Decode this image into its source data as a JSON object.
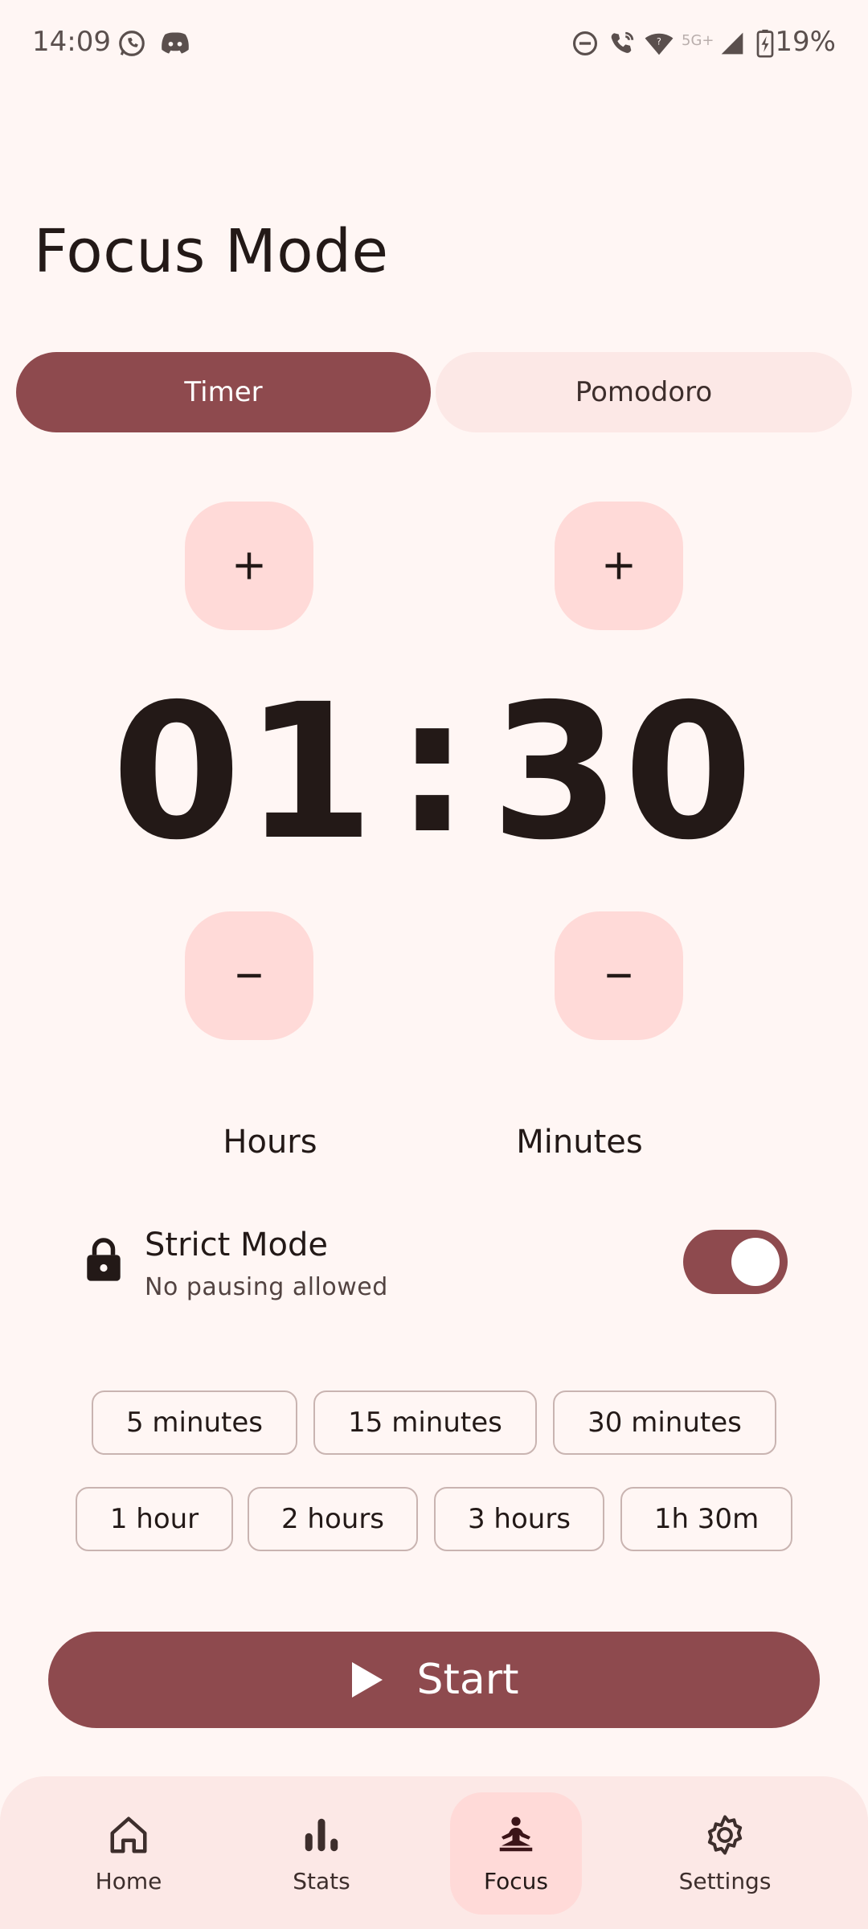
{
  "status_bar": {
    "time": "14:09",
    "network_label": "5G+",
    "battery": "19%"
  },
  "page": {
    "title": "Focus Mode"
  },
  "tabs": [
    {
      "label": "Timer",
      "selected": true
    },
    {
      "label": "Pomodoro",
      "selected": false
    }
  ],
  "timer": {
    "hours": "01",
    "separator": ":",
    "minutes": "30",
    "hours_label": "Hours",
    "minutes_label": "Minutes"
  },
  "strict_mode": {
    "title": "Strict Mode",
    "subtitle": "No pausing allowed",
    "enabled": true
  },
  "presets": [
    [
      "5 minutes",
      "15 minutes",
      "30 minutes"
    ],
    [
      "1 hour",
      "2 hours",
      "3 hours",
      "1h 30m"
    ]
  ],
  "start_button": {
    "label": "Start"
  },
  "bottom_nav": [
    {
      "label": "Home",
      "icon": "home-icon",
      "active": false
    },
    {
      "label": "Stats",
      "icon": "bar-chart-icon",
      "active": false
    },
    {
      "label": "Focus",
      "icon": "meditation-icon",
      "active": true
    },
    {
      "label": "Settings",
      "icon": "gear-icon",
      "active": false
    }
  ],
  "colors": {
    "background": "#FFF6F4",
    "primary": "#8E4A4E",
    "tonal": "#FFDAD8",
    "surface_container": "#FCE8E6",
    "on_surface": "#231917",
    "outline": "#C9B4B1"
  }
}
